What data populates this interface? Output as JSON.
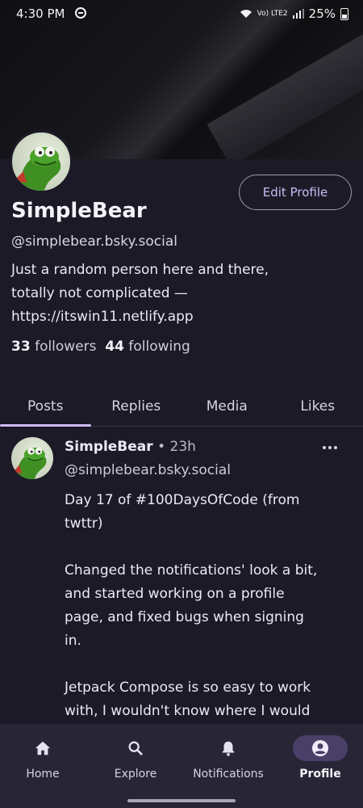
{
  "status_bar": {
    "time": "4:30 PM",
    "network": "Vo) LTE2",
    "battery": "25%"
  },
  "profile": {
    "name": "SimpleBear",
    "handle": "@simplebear.bsky.social",
    "bio": "Just a random person here and there,\ntotally not complicated —\nhttps://itswin11.netlify.app",
    "edit_button": "Edit Profile",
    "followers_count": "33",
    "followers_label": "followers",
    "following_count": "44",
    "following_label": "following"
  },
  "tabs": [
    {
      "label": "Posts",
      "active": true
    },
    {
      "label": "Replies",
      "active": false
    },
    {
      "label": "Media",
      "active": false
    },
    {
      "label": "Likes",
      "active": false
    }
  ],
  "post": {
    "author": "SimpleBear",
    "separator": "•",
    "time": "23h",
    "handle": "@simplebear.bsky.social",
    "text": "Day 17 of #100DaysOfCode (from\ntwttr)\n\nChanged the notifications' look a bit,\nand started working on a profile\npage, and fixed bugs when signing\nin.\n\nJetpack Compose is so easy to work\nwith, I wouldn't know where I would"
  },
  "bottom_nav": [
    {
      "label": "Home",
      "icon": "home-icon",
      "active": false
    },
    {
      "label": "Explore",
      "icon": "search-icon",
      "active": false
    },
    {
      "label": "Notifications",
      "icon": "bell-icon",
      "active": false
    },
    {
      "label": "Profile",
      "icon": "account-circle-icon",
      "active": true
    }
  ],
  "colors": {
    "background": "#1c1a27",
    "accent": "#cbbcf5",
    "nav_background": "#282537",
    "active_pill": "#4a3f66"
  }
}
